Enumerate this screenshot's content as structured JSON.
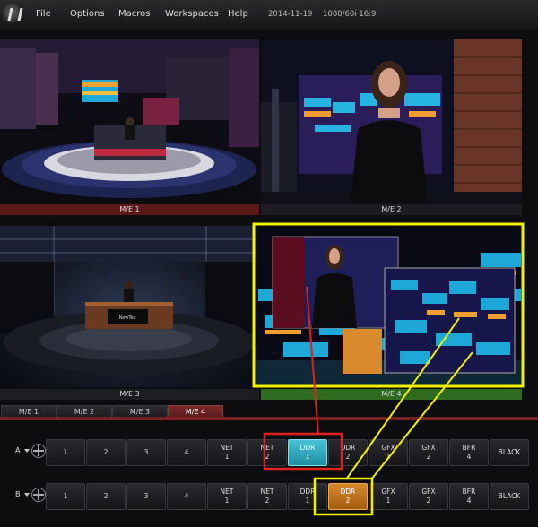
{
  "menubar": {
    "logo": "newtek-logo",
    "items": [
      "File",
      "Options",
      "Macros",
      "Workspaces",
      "Help"
    ],
    "date": "2014-11-19",
    "format": "1080/60i 16:9"
  },
  "monitors": [
    {
      "label": "M/E 1",
      "bar_color": "#5a1818"
    },
    {
      "label": "M/E 2",
      "bar_color": "#1c1c22"
    },
    {
      "label": "M/E 3",
      "bar_color": "#1c1c22"
    },
    {
      "label": "M/E 4",
      "bar_color": "#2e6b1e"
    }
  ],
  "scene3_logo_text": "NewTek",
  "switcher": {
    "tabs": [
      "M/E 1",
      "M/E 2",
      "M/E 3",
      "M/E 4"
    ],
    "active_tab": "M/E 4",
    "row_a": {
      "label": "A",
      "buttons": [
        "1",
        "2",
        "3",
        "4",
        "NET\n1",
        "NET\n2",
        "DDR\n1",
        "DDR\n2",
        "GFX\n1",
        "GFX\n2",
        "BFR\n4",
        "BLACK"
      ],
      "selected": "DDR\n1"
    },
    "row_b": {
      "label": "B",
      "buttons": [
        "1",
        "2",
        "3",
        "4",
        "NET\n1",
        "NET\n2",
        "DDR\n1",
        "DDR\n2",
        "GFX\n1",
        "GFX\n2",
        "BFR\n4",
        "BLACK"
      ],
      "selected": "DDR\n2"
    }
  },
  "colors": {
    "program_cyan": "#1e8fa3",
    "preview_orange": "#a45e12",
    "annotation_red": "#e02020",
    "annotation_yellow": "#f0f000"
  }
}
